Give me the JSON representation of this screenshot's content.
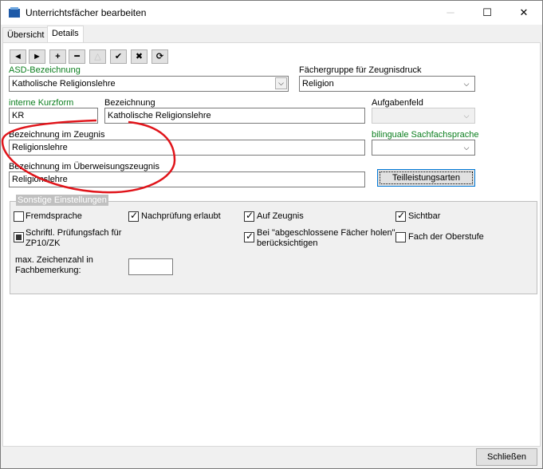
{
  "window": {
    "title": "Unterrichtsfächer bearbeiten",
    "min": "─",
    "max": "☐",
    "close": "✕"
  },
  "tabs": [
    "Übersicht",
    "Details"
  ],
  "toolbar": {
    "first": "◄",
    "next": "►",
    "add": "+",
    "remove": "━",
    "disabled_triangle": "△",
    "save": "✔",
    "cancel": "✖",
    "refresh": "⟳"
  },
  "form": {
    "asd_label": "ASD-Bezeichnung",
    "asd_value": "Katholische Religionslehre",
    "faechergruppe_label": "Fächergruppe für Zeugnisdruck",
    "faechergruppe_value": "Religion",
    "kurzform_label": "interne Kurzform",
    "kurzform_value": "KR",
    "bezeichnung_label": "Bezeichnung",
    "bezeichnung_value": "Katholische Religionslehre",
    "aufgabenfeld_label": "Aufgabenfeld",
    "aufgabenfeld_value": "",
    "zeugnis_label": "Bezeichnung im Zeugnis",
    "zeugnis_value": "Religionslehre",
    "bilingual_label": "bilinguale Sachfachsprache",
    "bilingual_value": "",
    "ueberweisung_label": "Bezeichnung im Überweisungszeugnis",
    "ueberweisung_value": "Religionslehre",
    "teilleistung_button": "Teilleistungsarten"
  },
  "sonstige": {
    "title": "Sonstige Einstellungen",
    "fremdsprache": "Fremdsprache",
    "nachpruefung": "Nachprüfung erlaubt",
    "auf_zeugnis": "Auf Zeugnis",
    "sichtbar": "Sichtbar",
    "pruefungsfach": "Schriftl. Prüfungsfach für ZP10/ZK",
    "abgeschlossene": "Bei \"abgeschlossene Fächer holen\" berücksichtigen",
    "oberstufe": "Fach der Oberstufe",
    "max_zeichen": "max. Zeichenzahl in Fachbemerkung:",
    "max_zeichen_value": ""
  },
  "footer": {
    "close_button": "Schließen"
  },
  "colors": {
    "label_green": "#0b7e1e",
    "annotation_red": "#e0141a",
    "accent": "#0078d7"
  }
}
